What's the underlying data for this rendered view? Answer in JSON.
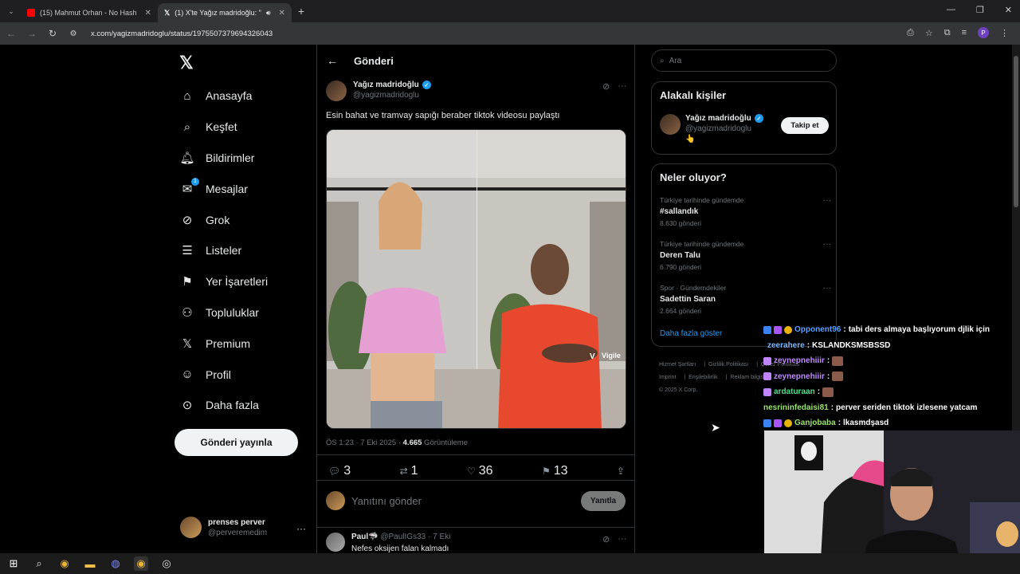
{
  "browser": {
    "tabs": [
      {
        "title": "(15) Mahmut Orhan - No Hash",
        "active": false,
        "favicon_color": "#ff0000"
      },
      {
        "title": "(1) X'te Yağız madridoğlu: \"",
        "active": true,
        "favicon_color": "#ffffff"
      }
    ],
    "url": "x.com/yagizmadridoglu/status/1975507379694326043",
    "profile_letter": "P"
  },
  "left_nav": {
    "items": [
      {
        "label": "Anasayfa",
        "icon": "home-icon",
        "glyph": "⌂"
      },
      {
        "label": "Keşfet",
        "icon": "search-icon",
        "glyph": "⌕"
      },
      {
        "label": "Bildirimler",
        "icon": "bell-icon",
        "glyph": "🔔︎"
      },
      {
        "label": "Mesajlar",
        "icon": "mail-icon",
        "glyph": "✉",
        "badge": "1"
      },
      {
        "label": "Grok",
        "icon": "grok-icon",
        "glyph": "⊘"
      },
      {
        "label": "Listeler",
        "icon": "list-icon",
        "glyph": "☰"
      },
      {
        "label": "Yer İşaretleri",
        "icon": "bookmark-icon",
        "glyph": "⚑"
      },
      {
        "label": "Topluluklar",
        "icon": "communities-icon",
        "glyph": "⚇"
      },
      {
        "label": "Premium",
        "icon": "x-premium-icon",
        "glyph": "𝕏"
      },
      {
        "label": "Profil",
        "icon": "profile-icon",
        "glyph": "☺"
      },
      {
        "label": "Daha fazla",
        "icon": "more-circle-icon",
        "glyph": "⊙"
      }
    ],
    "post_button": "Gönderi yayınla",
    "account": {
      "name": "prenses perver",
      "handle": "@perveremedim"
    }
  },
  "post": {
    "header_title": "Gönderi",
    "author_name": "Yağız madridoğlu",
    "author_handle": "@yagizmadridoglu",
    "text": "Esin bahat ve tramvay sapığı beraber tiktok videosu paylaştı",
    "time": "ÖS 1:23 · 7 Eki 2025 · ",
    "views": "4.665",
    "views_label": " Görüntüleme",
    "media_watermark": "Vigile",
    "stats": {
      "replies": "3",
      "reposts": "1",
      "likes": "36",
      "bookmarks": "13"
    },
    "reply_placeholder": "Yanıtını gönder",
    "reply_button": "Yanıtla"
  },
  "first_reply": {
    "name": "Paul🦈",
    "handle": "@PaulIGs33",
    "date": "7 Eki",
    "text": "Nefes oksijen falan kalmadı"
  },
  "right": {
    "search_placeholder": "Ara",
    "related_title": "Alakalı kişiler",
    "related_person": {
      "name": "Yağız madridoğlu",
      "handle": "@yagizmadridoglu",
      "bio": "👆"
    },
    "follow_button": "Takip et",
    "trends_title": "Neler oluyor?",
    "trends": [
      {
        "context": "Türkiye tarihinde gündemde",
        "name": "#sallandık",
        "count": "8.630 gönderi"
      },
      {
        "context": "Türkiye tarihinde gündemde",
        "name": "Deren Talu",
        "count": "6.790 gönderi"
      },
      {
        "context": "Spor · Gündemdekiler",
        "name": "Sadettin Saran",
        "count": "2.664 gönderi"
      }
    ],
    "show_more": "Daha fazla göster",
    "footer": [
      "Hizmet Şartları",
      "Gizlilik Politikası",
      "Çerez Politikası",
      "Imprint",
      "Erişilebilirlik",
      "Reklam bilgisi",
      "© 2025 X Corp."
    ]
  },
  "chat": [
    {
      "user": "Opponent96",
      "color": "#5aa0ff",
      "message": "tabi ders almaya başlıyorum djlik için"
    },
    {
      "user": "zeerahere",
      "color": "#7ab8ff",
      "message": "KSLANDKSMSBSSD"
    },
    {
      "user": "zeynepnehiiir",
      "color": "#c08bff",
      "message": ""
    },
    {
      "user": "zeynepnehiiir",
      "color": "#c08bff",
      "message": ""
    },
    {
      "user": "ardaturaan",
      "color": "#4ee08a",
      "message": ""
    },
    {
      "user": "nesrininfedaisi81",
      "color": "#9be36b",
      "message": "perver seriden tiktok izlesene yatcam"
    },
    {
      "user": "Ganjobaba",
      "color": "#9be36b",
      "message": "lkasmdşasd"
    }
  ]
}
